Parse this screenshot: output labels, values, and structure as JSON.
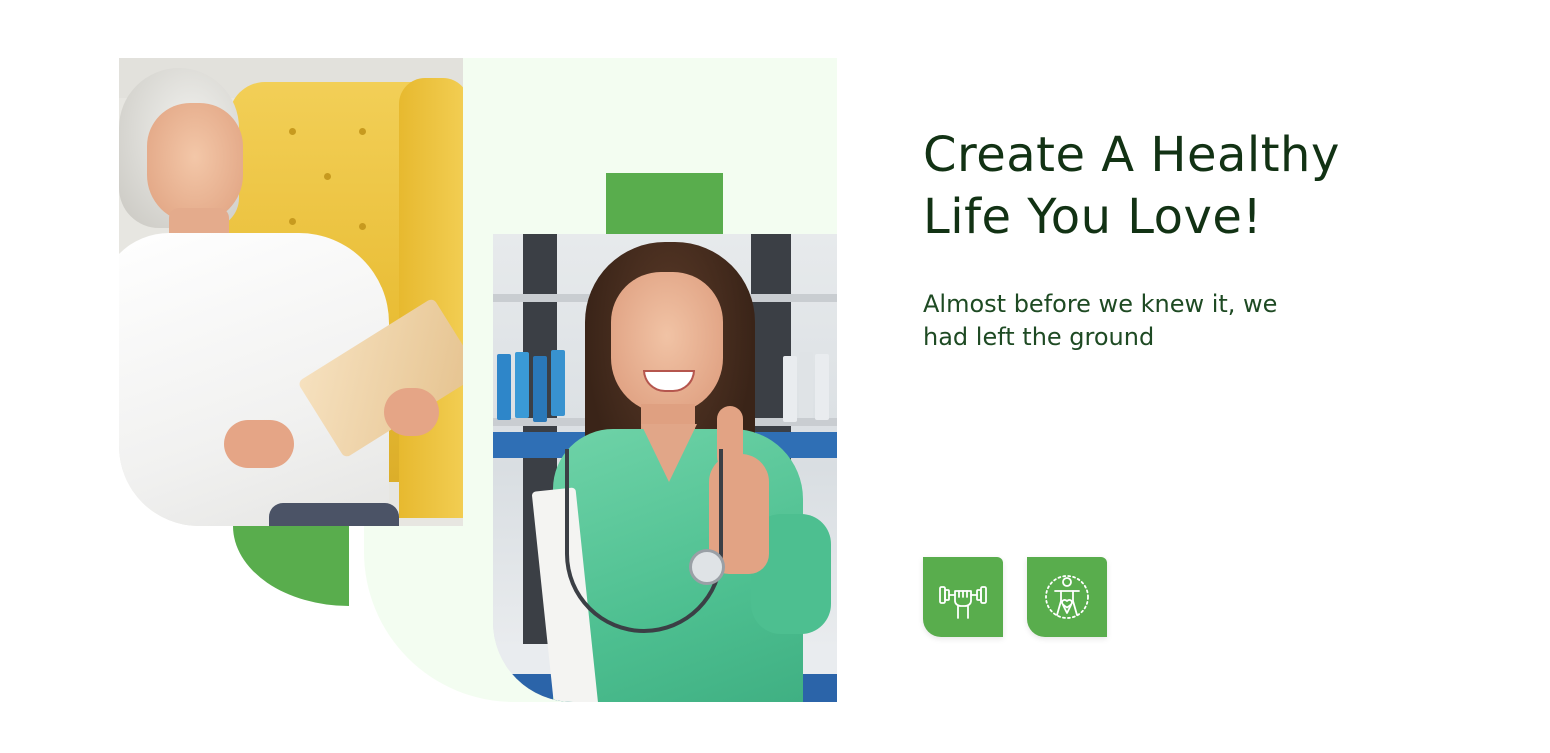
{
  "hero": {
    "heading_line1": "Create A Healthy",
    "heading_line2": "Life You Love!",
    "subtitle_line1": "Almost before we knew it, we",
    "subtitle_line2": "had left the ground"
  },
  "features": [
    {
      "icon": "dumbbell-fist-icon"
    },
    {
      "icon": "body-heart-icon"
    }
  ],
  "colors": {
    "accent_green": "#59ad4d",
    "mint_background": "#f3fdf1",
    "heading_text": "#123214",
    "subtitle_text": "#1e4a23"
  }
}
